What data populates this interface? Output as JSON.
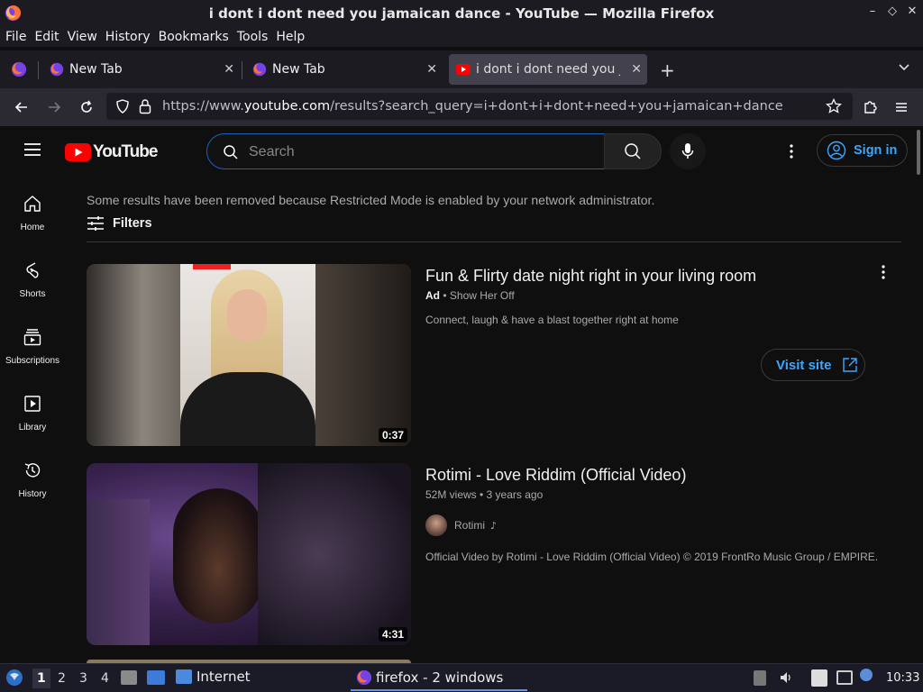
{
  "window": {
    "title": "i dont i dont need you jamaican dance - YouTube — Mozilla Firefox",
    "controls": [
      "–",
      "◇",
      "✕"
    ]
  },
  "menu": [
    "File",
    "Edit",
    "View",
    "History",
    "Bookmarks",
    "Tools",
    "Help"
  ],
  "tabs": [
    {
      "label": "New Tab",
      "active": false
    },
    {
      "label": "New Tab",
      "active": false
    },
    {
      "label": "i dont i dont need you ja",
      "active": true
    }
  ],
  "address": {
    "prefix": "https://www.",
    "domain": "youtube.com",
    "path": "/results?search_query=i+dont+i+dont+need+you+jamaican+dance"
  },
  "youtube": {
    "brand": "YouTube",
    "search_placeholder": "Search",
    "sign_in": "Sign in",
    "sidebar": [
      {
        "label": "Home",
        "icon": "home-icon"
      },
      {
        "label": "Shorts",
        "icon": "shorts-icon"
      },
      {
        "label": "Subscriptions",
        "icon": "subscriptions-icon"
      },
      {
        "label": "Library",
        "icon": "library-icon"
      },
      {
        "label": "History",
        "icon": "history-icon"
      }
    ],
    "notice": "Some results have been removed because Restricted Mode is enabled by your network administrator.",
    "filters": "Filters",
    "results": [
      {
        "title": "Fun & Flirty date night right in your living room",
        "ad_badge": "Ad",
        "meta": "Show Her Off",
        "description": "Connect, laugh & have a blast together right at home",
        "duration": "0:37",
        "cta": "Visit site"
      },
      {
        "title": "Rotimi - Love Riddim (Official Video)",
        "meta": "52M views • 3 years ago",
        "channel": "Rotimi",
        "description": "Official Video by Rotimi - Love Riddim (Official Video) © 2019 FrontRo Music Group / EMPIRE.",
        "duration": "4:31"
      }
    ]
  },
  "taskbar": {
    "workspaces": [
      "1",
      "2",
      "3",
      "4"
    ],
    "internet_label": "Internet",
    "firefox_label": "firefox - 2 windows",
    "clock": "10:33"
  },
  "colors": {
    "accent_blue": "#3ea6ff",
    "yt_red": "#ff0000",
    "background": "#0f0f0f"
  }
}
